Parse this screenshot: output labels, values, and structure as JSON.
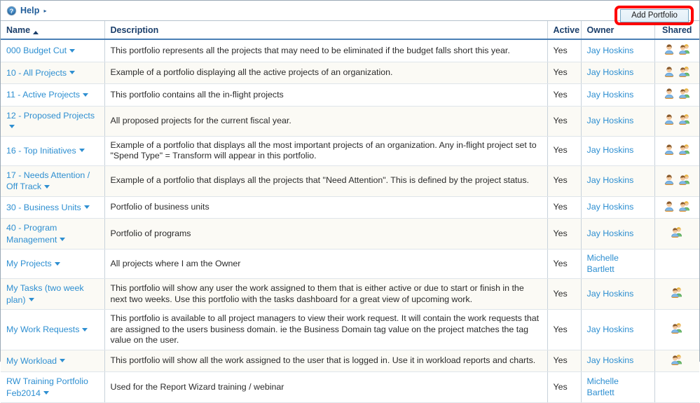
{
  "help": {
    "label": "Help",
    "icon": "help-question-icon",
    "caret": "▸"
  },
  "toolbar": {
    "add_portfolio_label": "Add Portfolio",
    "annotation_color": "#fe0000"
  },
  "table": {
    "columns": [
      {
        "key": "name",
        "label": "Name",
        "sorted": "asc"
      },
      {
        "key": "description",
        "label": "Description",
        "sorted": null
      },
      {
        "key": "active",
        "label": "Active",
        "sorted": null
      },
      {
        "key": "owner",
        "label": "Owner",
        "sorted": null
      },
      {
        "key": "shared",
        "label": "Shared",
        "sorted": null
      }
    ],
    "rows": [
      {
        "name": "000 Budget Cut",
        "description": "This portfolio represents all the projects that may need to be eliminated if the budget falls short this year.",
        "active": "Yes",
        "owner": "Jay Hoskins",
        "shared_icons": [
          "user-icon",
          "shared-group-icon"
        ]
      },
      {
        "name": "10 - All Projects",
        "description": "Example of a portfolio displaying all the active projects of an organization.",
        "active": "Yes",
        "owner": "Jay Hoskins",
        "shared_icons": [
          "user-icon",
          "shared-group-icon"
        ]
      },
      {
        "name": "11 - Active Projects",
        "description": "This portfolio contains all the in-flight projects",
        "active": "Yes",
        "owner": "Jay Hoskins",
        "shared_icons": [
          "user-icon",
          "shared-group-icon"
        ]
      },
      {
        "name": "12 - Proposed Projects",
        "description": "All proposed projects for the current fiscal year.",
        "active": "Yes",
        "owner": "Jay Hoskins",
        "shared_icons": [
          "user-icon",
          "shared-group-icon"
        ]
      },
      {
        "name": "16 - Top Initiatives",
        "description": "Example of a portfolio that displays all the most important projects of an organization. Any in-flight project set to \"Spend Type\" = Transform will appear in this portfolio.",
        "active": "Yes",
        "owner": "Jay Hoskins",
        "shared_icons": [
          "user-icon",
          "shared-group-icon"
        ]
      },
      {
        "name": "17 - Needs Attention / Off Track",
        "description": "Example of a portfolio that displays all the projects that \"Need Attention\". This is defined by the project status.",
        "active": "Yes",
        "owner": "Jay Hoskins",
        "shared_icons": [
          "user-icon",
          "shared-group-icon"
        ]
      },
      {
        "name": "30 - Business Units",
        "description": "Portfolio of business units",
        "active": "Yes",
        "owner": "Jay Hoskins",
        "shared_icons": [
          "user-icon",
          "shared-group-icon"
        ]
      },
      {
        "name": "40 - Program Management",
        "description": "Portfolio of programs",
        "active": "Yes",
        "owner": "Jay Hoskins",
        "shared_icons": [
          "shared-group-icon"
        ]
      },
      {
        "name": "My Projects",
        "description": "All projects where I am the Owner",
        "active": "Yes",
        "owner": "Michelle Bartlett",
        "shared_icons": []
      },
      {
        "name": "My Tasks (two week plan)",
        "description": "This portfolio will show any user the work assigned to them that is either active or due to start or finish in the next two weeks. Use this portfolio with the tasks dashboard for a great view of upcoming work.",
        "active": "Yes",
        "owner": "Jay Hoskins",
        "shared_icons": [
          "shared-group-icon"
        ]
      },
      {
        "name": "My Work Requests",
        "description": "This portfolio is available to all project managers to view their work request. It will contain the work requests that are assigned to the users business domain. ie the Business Domain tag value on the project matches the tag value on the user.",
        "active": "Yes",
        "owner": "Jay Hoskins",
        "shared_icons": [
          "shared-group-icon"
        ]
      },
      {
        "name": "My Workload",
        "description": "This portfolio will show all the work assigned to the user that is logged in. Use it in workload reports and charts.",
        "active": "Yes",
        "owner": "Jay Hoskins",
        "shared_icons": [
          "shared-group-icon"
        ]
      },
      {
        "name": "RW Training Portfolio Feb2014",
        "description": "Used for the Report Wizard training / webinar",
        "active": "Yes",
        "owner": "Michelle Bartlett",
        "shared_icons": []
      }
    ]
  },
  "colors": {
    "link": "#2e8fd1",
    "header_text": "#1b3f6b",
    "header_rule": "#4a7fb5",
    "alt_row": "#fbfaf5",
    "annotation": "#fe0000"
  }
}
